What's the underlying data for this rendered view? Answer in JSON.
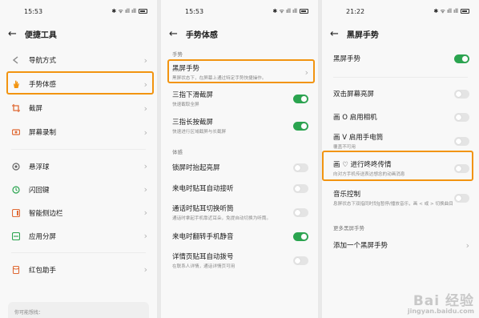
{
  "p1": {
    "time": "15:53",
    "status_icons": "✱ ᯤ ıll ıll",
    "title": "便捷工具",
    "items": [
      {
        "label": "导航方式"
      },
      {
        "label": "手势体感"
      },
      {
        "label": "截屏"
      },
      {
        "label": "屏幕录制"
      },
      {
        "label": "悬浮球"
      },
      {
        "label": "闪回键"
      },
      {
        "label": "智能侧边栏"
      },
      {
        "label": "应用分屏"
      },
      {
        "label": "红包助手"
      }
    ],
    "footer_hint": "你可能想找："
  },
  "p2": {
    "time": "15:53",
    "status_icons": "✱ ᯤ ıll ıll",
    "title": "手势体感",
    "section_gesture": "手势",
    "section_motion": "体感",
    "items": [
      {
        "label": "黑屏手势",
        "sub": "黑屏状态下，在屏幕上通过特定手势快捷操作。"
      },
      {
        "label": "三指下滑截屏",
        "sub": "快速截取全屏",
        "on": true
      },
      {
        "label": "三指长按截屏",
        "sub": "快速进行区域截屏与长截屏",
        "on": true
      },
      {
        "label": "锁屏时抬起亮屏",
        "on": false
      },
      {
        "label": "来电时贴耳自动接听",
        "on": false
      },
      {
        "label": "通话时贴耳切换听筒",
        "sub": "通话时拿起手机靠近耳朵，免提自动切换为听筒。",
        "on": false
      },
      {
        "label": "来电时翻转手机静音",
        "on": true
      },
      {
        "label": "详情页贴耳自动拨号",
        "sub": "在联系人详情，通话详情页可用",
        "on": false
      }
    ]
  },
  "p3": {
    "time": "21:22",
    "status_icons": "✱ ᯤ ıll ıll",
    "title": "黑屏手势",
    "master_label": "黑屏手势",
    "master_on": true,
    "items": [
      {
        "label": "双击屏幕亮屏",
        "on": false
      },
      {
        "label": "画 O 启用相机",
        "on": false
      },
      {
        "label": "画 V 启用手电筒",
        "sub": "覆盖不可用",
        "on": false
      },
      {
        "label": "画 ♡ 进行咚咚传情",
        "sub": "向对方手机传送表达想念的动画消息",
        "on": false
      },
      {
        "label": "音乐控制",
        "sub": "息屏状态下双指同时划‖暂停/播放音乐，画 < 或 > 切换曲目",
        "on": false
      }
    ],
    "more_section": "更多黑屏手势",
    "add_label": "添加一个黑屏手势"
  },
  "watermark": {
    "line1": "Bai 经验",
    "line2": "jingyan.baidu.com"
  },
  "colors": {
    "accent_green": "#2aa44f",
    "highlight_orange": "#f29410"
  }
}
